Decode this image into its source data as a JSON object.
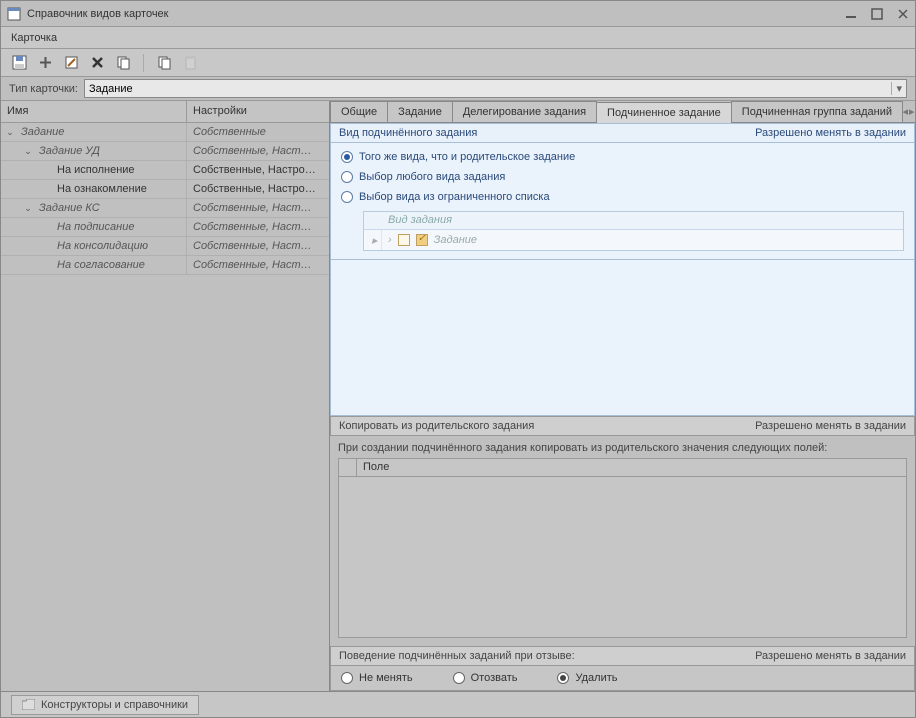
{
  "window": {
    "title": "Справочник видов карточек"
  },
  "menubar": {
    "card": "Карточка"
  },
  "typeRow": {
    "label": "Тип карточки:",
    "value": "Задание"
  },
  "tree": {
    "headers": {
      "name": "Имя",
      "settings": "Настройки"
    },
    "rows": [
      {
        "indent": 0,
        "expander": "v",
        "name": "Задание",
        "set": "Собственные",
        "italic": true
      },
      {
        "indent": 1,
        "expander": "v",
        "name": "Задание УД",
        "set": "Собственные, Наст…",
        "italic": true
      },
      {
        "indent": 2,
        "expander": "",
        "name": "На исполнение",
        "set": "Собственные, Настро…",
        "italic": false
      },
      {
        "indent": 2,
        "expander": "",
        "name": "На ознакомление",
        "set": "Собственные, Настро…",
        "italic": false
      },
      {
        "indent": 1,
        "expander": "v",
        "name": "Задание КС",
        "set": "Собственные, Наст…",
        "italic": true
      },
      {
        "indent": 2,
        "expander": "",
        "name": "На подписание",
        "set": "Собственные, Наст…",
        "italic": true
      },
      {
        "indent": 2,
        "expander": "",
        "name": "На консолидацию",
        "set": "Собственные, Наст…",
        "italic": true
      },
      {
        "indent": 2,
        "expander": "",
        "name": "На согласование",
        "set": "Собственные, Наст…",
        "italic": true
      }
    ]
  },
  "tabs": {
    "items": [
      "Общие",
      "Задание",
      "Делегирование задания",
      "Подчиненное задание",
      "Подчиненная группа заданий"
    ],
    "active": 3
  },
  "subtask": {
    "headLeft": "Вид подчинённого задания",
    "headRight": "Разрешено менять в задании",
    "radios": [
      "Того же вида, что и родительское задание",
      "Выбор любого вида задания",
      "Выбор вида из ограниченного списка"
    ],
    "radioChecked": 0,
    "subHeader": "Вид задания",
    "subRow": "Задание"
  },
  "copy": {
    "headLeft": "Копировать из родительского задания",
    "headRight": "Разрешено менять в задании",
    "text": "При создании подчинённого задания копировать из родительского значения следующих полей:",
    "fieldHeader": "Поле"
  },
  "behavior": {
    "headLeft": "Поведение подчинённых заданий при отзыве:",
    "headRight": "Разрешено менять в задании",
    "options": [
      "Не менять",
      "Отозвать",
      "Удалить"
    ],
    "checked": 2
  },
  "footer": {
    "tab": "Конструкторы и справочники"
  }
}
